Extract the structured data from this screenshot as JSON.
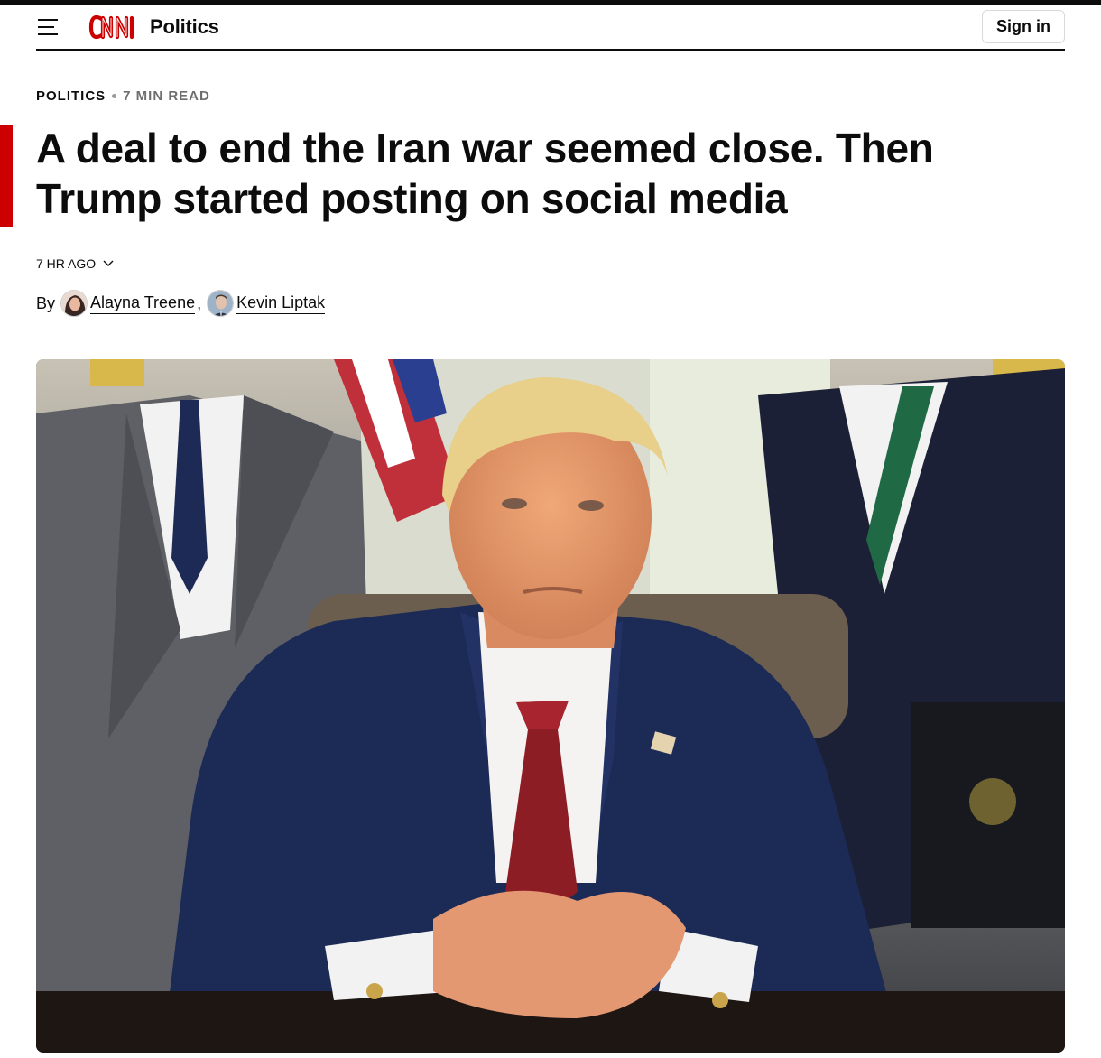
{
  "header": {
    "menu_icon": "hamburger-menu-icon",
    "logo_text": "CNN",
    "section_name": "Politics",
    "signin_label": "Sign in"
  },
  "article": {
    "section": "POLITICS",
    "read_time": "7 MIN READ",
    "headline": "A deal to end the Iran war seemed close. Then Trump started posting on social media",
    "timestamp": "7 HR AGO",
    "byline_prefix": "By",
    "authors": [
      {
        "name": "Alayna Treene",
        "avatar_icon": "author-avatar"
      },
      {
        "name": "Kevin Liptak",
        "avatar_icon": "author-avatar"
      }
    ],
    "author_separator": ","
  },
  "colors": {
    "brand_red": "#cc0000",
    "text": "#0c0c0c",
    "muted": "#6e6e6e"
  }
}
